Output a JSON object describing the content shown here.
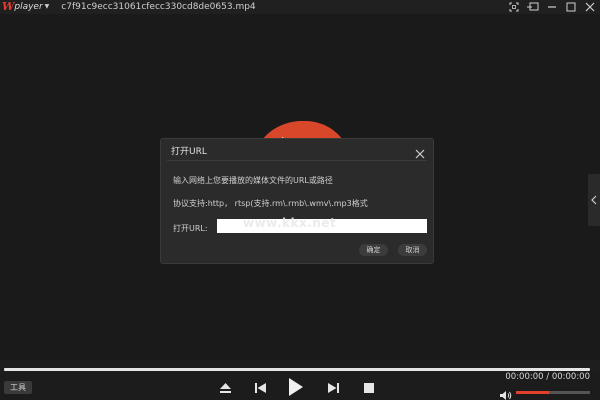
{
  "app": {
    "logo_mark": "W",
    "logo_text": "player",
    "file_name": "c7f91c9ecc31061cfecc330cd8de0653.mp4"
  },
  "window_controls": [
    "fullscreen-icon",
    "mini-mode-icon",
    "minimize-icon",
    "restore-icon",
    "close-icon"
  ],
  "dialog": {
    "title": "打开URL",
    "description": "输入网络上您要播放的媒体文件的URL或路径",
    "protocols": "协议支持:http，  rtsp(支持.rm\\.rmb\\.wmv\\.mp3格式",
    "url_label": "打开URL:",
    "url_value": "",
    "ok_label": "确定",
    "cancel_label": "取消"
  },
  "watermark": "www.kkx.net",
  "controls": {
    "tools_label": "工具",
    "time": "00:00:00 / 00:00:00",
    "volume_level": 0.45,
    "buttons": [
      "eject-icon",
      "previous-icon",
      "play-icon",
      "next-icon",
      "stop-icon"
    ]
  },
  "colors": {
    "brand": "#e23b2e",
    "volume_fill": "#e0402c",
    "dialog_bg": "#2b2b2b"
  }
}
